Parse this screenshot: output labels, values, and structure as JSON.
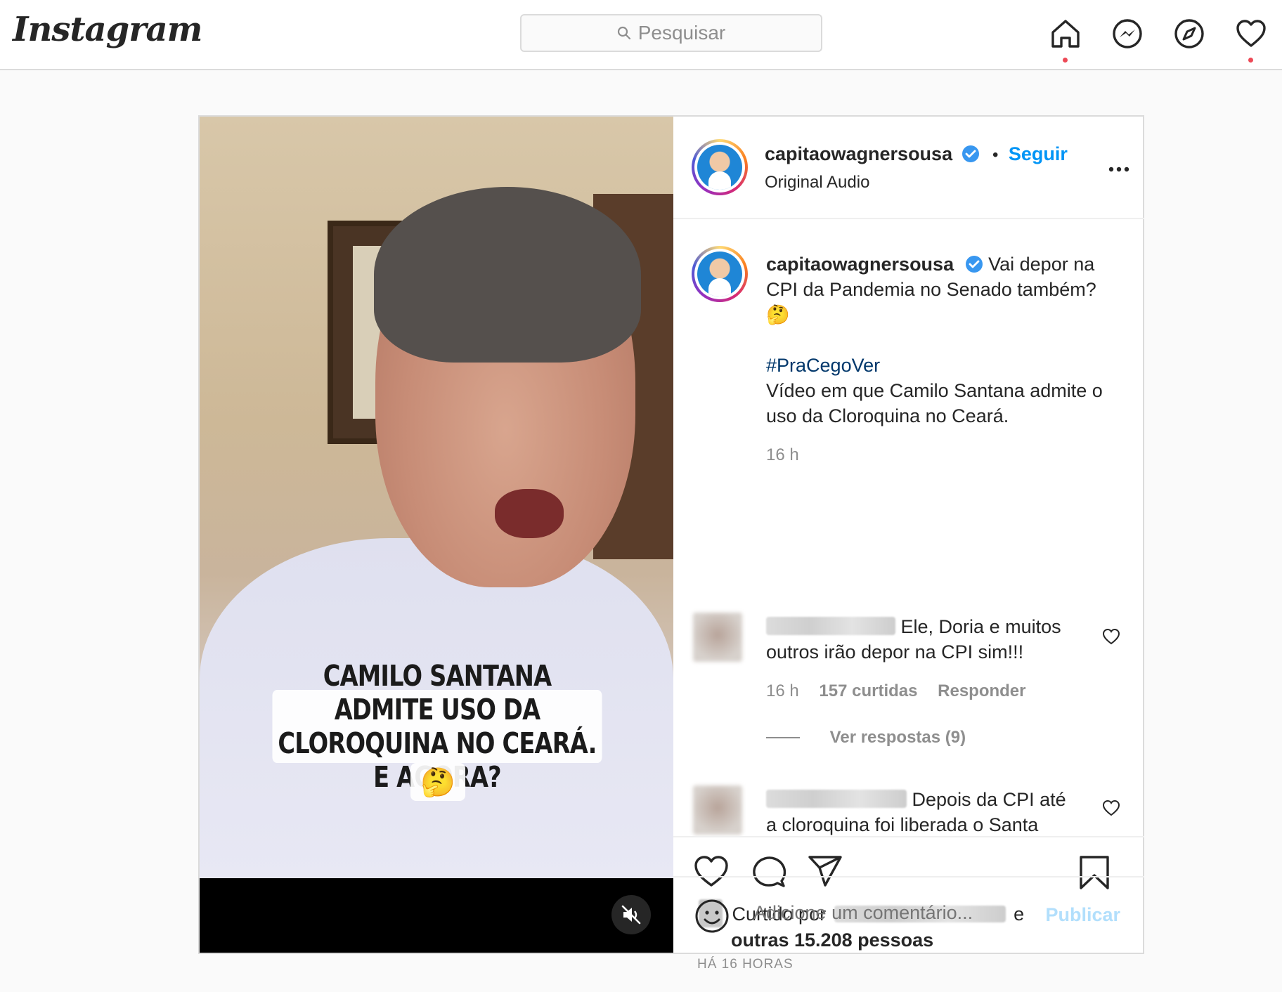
{
  "topbar": {
    "logo": "Instagram",
    "search_placeholder": "Pesquisar"
  },
  "video": {
    "caption_line1": "CAMILO SANTANA ADMITE USO DA",
    "caption_line2": "CLOROQUINA NO CEARÁ. E AGORA?",
    "caption_emoji": "🤔",
    "muted": true
  },
  "post_header": {
    "username": "capitaowagnersousa",
    "follow_label": "Seguir",
    "audio": "Original Audio"
  },
  "caption": {
    "username": "capitaowagnersousa",
    "text_line": "Vai depor na CPI da Pandemia no Senado também?",
    "emoji": "🤔",
    "hashtag": "#PraCegoVer",
    "description": "Vídeo em que Camilo Santana admite o uso da Cloroquina no Ceará.",
    "time": "16 h"
  },
  "comments": [
    {
      "text": "Ele, Doria e muitos outros irão depor na CPI sim!!!",
      "time": "16 h",
      "likes": "157 curtidas",
      "reply_label": "Responder",
      "view_replies": "Ver respostas (9)"
    },
    {
      "text": "Depois da CPI até a cloroquina foi liberada o Santa"
    }
  ],
  "likes": {
    "prefix": "Curtido por",
    "suffix": "e",
    "others": "outras 15.208 pessoas",
    "time_ago": "HÁ 16 HORAS"
  },
  "add_comment": {
    "placeholder": "Adicione um comentário...",
    "publish_label": "Publicar"
  },
  "colors": {
    "link_blue": "#0095f6",
    "hashtag_blue": "#00376b",
    "notification_red": "#ed4956",
    "publish_disabled": "#b2dffc"
  }
}
